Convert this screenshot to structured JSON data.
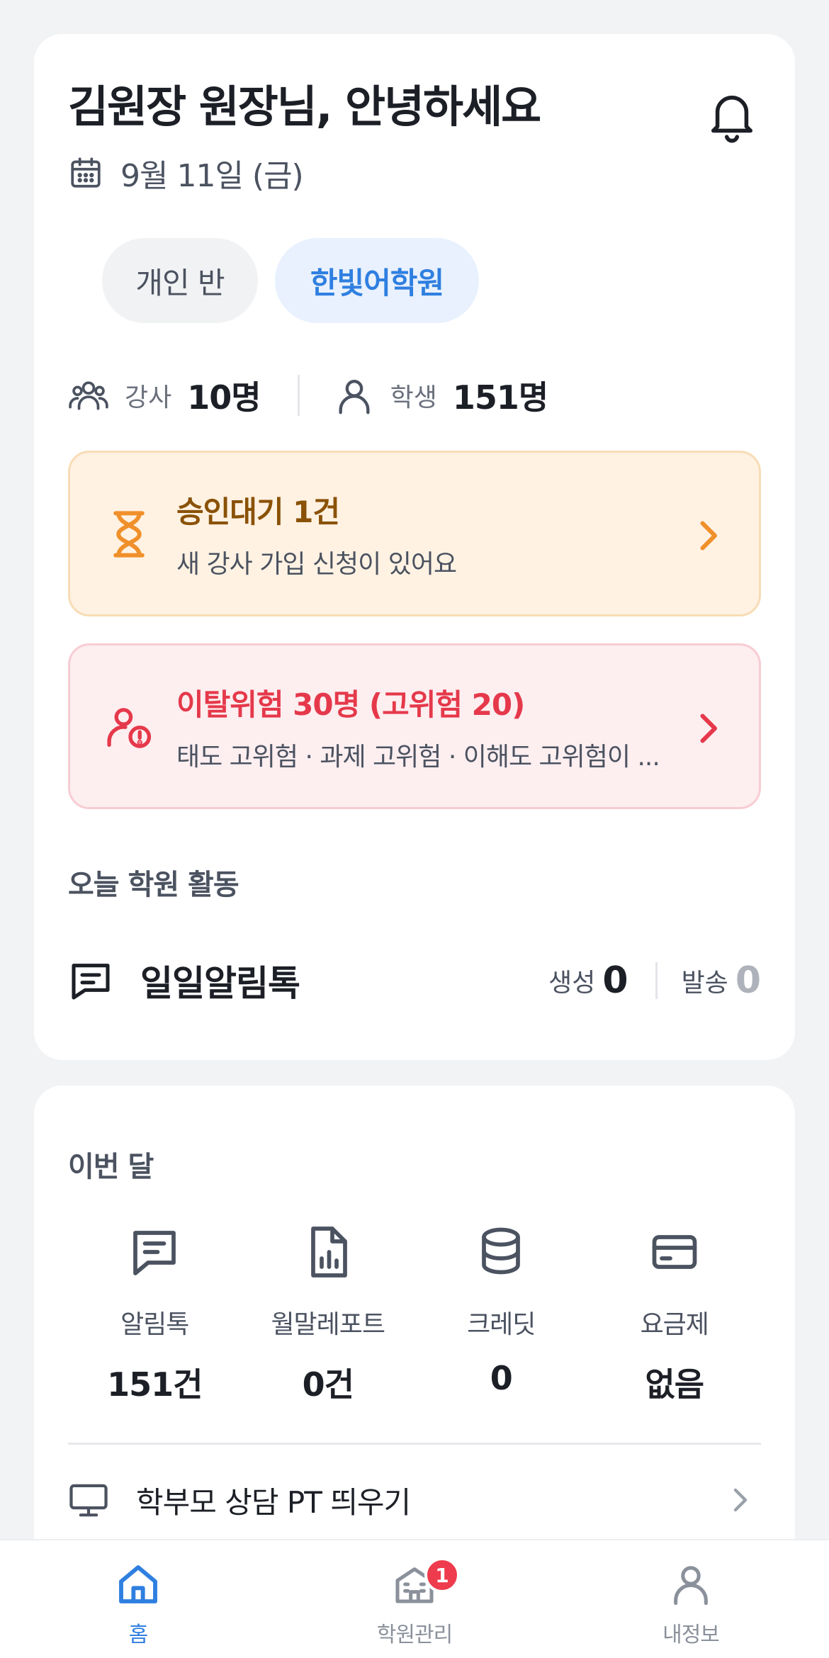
{
  "header": {
    "greeting": "김원장 원장님, 안녕하세요",
    "date": "9월 11일 (금)"
  },
  "class_tabs": [
    {
      "label": "개인 반",
      "selected": false
    },
    {
      "label": "한빛어학원",
      "selected": true
    }
  ],
  "stats": {
    "teachers_label": "강사",
    "teachers_value": "10명",
    "students_label": "학생",
    "students_value": "151명"
  },
  "alerts": {
    "approval": {
      "title": "승인대기 1건",
      "subtitle": "새 강사 가입 신청이 있어요",
      "color": "#8a5207"
    },
    "risk": {
      "title": "이탈위험 30명 (고위험 20)",
      "subtitle": "태도 고위험 · 과제 고위험 · 이해도 고위험이 ...",
      "color": "#e5394b"
    }
  },
  "today": {
    "section_title": "오늘 학원 활동",
    "item_title": "일일알림톡",
    "created_label": "생성",
    "created_value": "0",
    "sent_label": "발송",
    "sent_value": "0"
  },
  "month": {
    "section_title": "이번 달",
    "items": [
      {
        "icon": "message-icon",
        "label": "알림톡",
        "value": "151건"
      },
      {
        "icon": "report-icon",
        "label": "월말레포트",
        "value": "0건"
      },
      {
        "icon": "database-icon",
        "label": "크레딧",
        "value": "0"
      },
      {
        "icon": "card-icon",
        "label": "요금제",
        "value": "없음"
      }
    ],
    "pt_label": "학부모 상담 PT 띄우기"
  },
  "tabbar": {
    "home": "홈",
    "academy": "학원관리",
    "academy_badge": "1",
    "profile": "내정보"
  },
  "colors": {
    "accent": "#2f7fe0",
    "warning_bg": "#fff2e3",
    "danger_bg": "#fdeef0",
    "badge": "#ee3b4d"
  }
}
